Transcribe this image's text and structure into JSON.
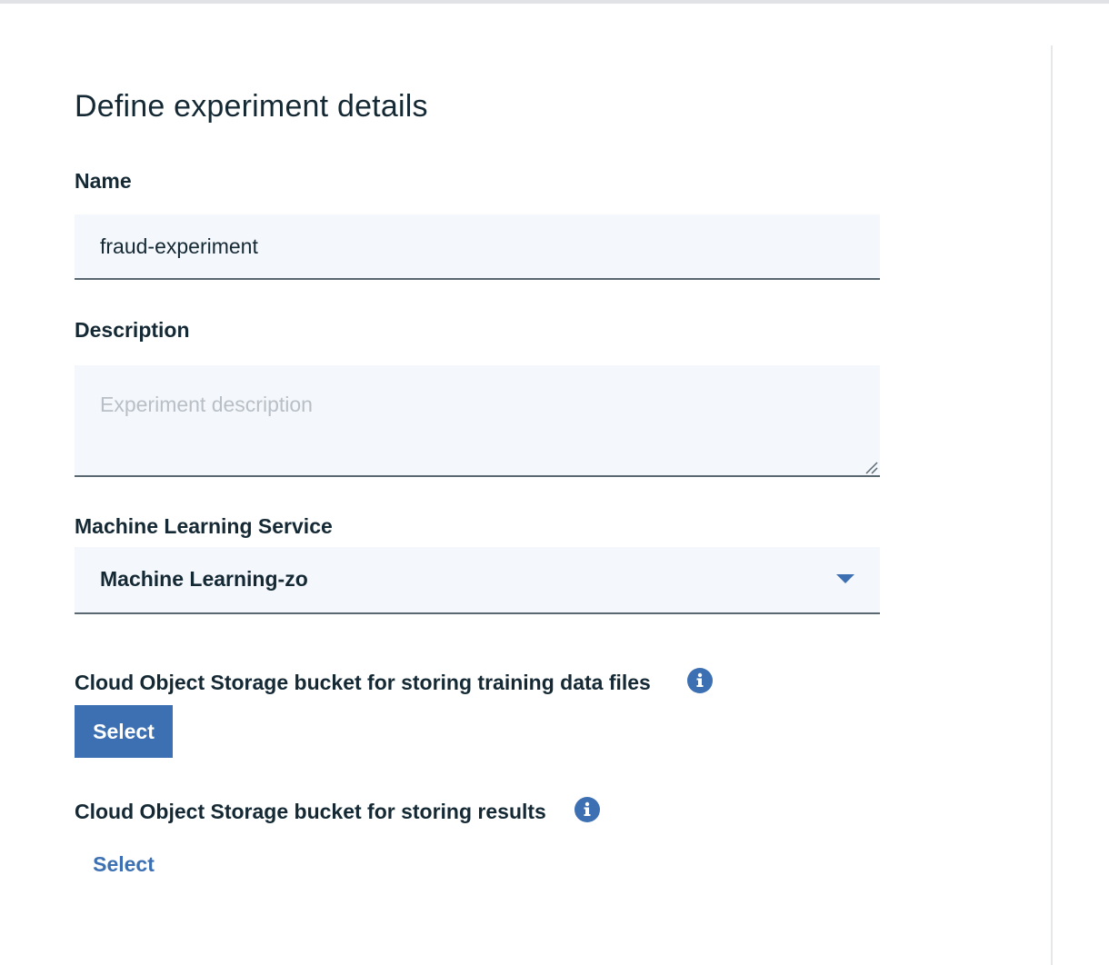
{
  "page": {
    "title": "Define experiment details"
  },
  "form": {
    "name": {
      "label": "Name",
      "value": "fraud-experiment"
    },
    "description": {
      "label": "Description",
      "placeholder": "Experiment description",
      "value": ""
    },
    "ml_service": {
      "label": "Machine Learning Service",
      "selected": "Machine Learning-zo"
    },
    "training_bucket": {
      "label": "Cloud Object Storage bucket for storing training data files",
      "button_label": "Select",
      "info_icon": "info-icon"
    },
    "results_bucket": {
      "label": "Cloud Object Storage bucket for storing results",
      "button_label": "Select",
      "info_icon": "info-icon"
    }
  },
  "colors": {
    "accent": "#3d70b2",
    "text": "#152935",
    "field_bg": "#f4f7fb",
    "field_border": "#5a6872",
    "placeholder": "#b8bfc6"
  }
}
